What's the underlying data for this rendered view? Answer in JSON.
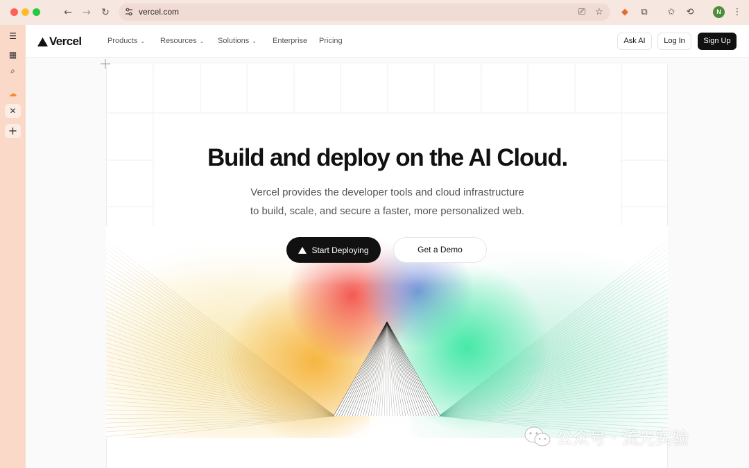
{
  "browser": {
    "url": "vercel.com",
    "avatar_initial": "N"
  },
  "nav": {
    "brand": "Vercel",
    "menu": [
      {
        "label": "Products",
        "has_dropdown": true
      },
      {
        "label": "Resources",
        "has_dropdown": true
      },
      {
        "label": "Solutions",
        "has_dropdown": true
      },
      {
        "label": "Enterprise",
        "has_dropdown": false
      },
      {
        "label": "Pricing",
        "has_dropdown": false
      }
    ],
    "ask_ai": "Ask AI",
    "log_in": "Log In",
    "sign_up": "Sign Up"
  },
  "hero": {
    "title": "Build and deploy on the AI Cloud.",
    "subtitle_line1": "Vercel provides the developer tools and cloud infrastructure",
    "subtitle_line2": "to build, scale, and secure a faster, more personalized web.",
    "primary_cta": "Start Deploying",
    "secondary_cta": "Get a Demo"
  },
  "watermark": {
    "text": "公众号 · 流光实验"
  },
  "colors": {
    "accent_dark": "#111111",
    "titlebar": "#f7e7e1",
    "sidebar": "#fbd9c9"
  }
}
